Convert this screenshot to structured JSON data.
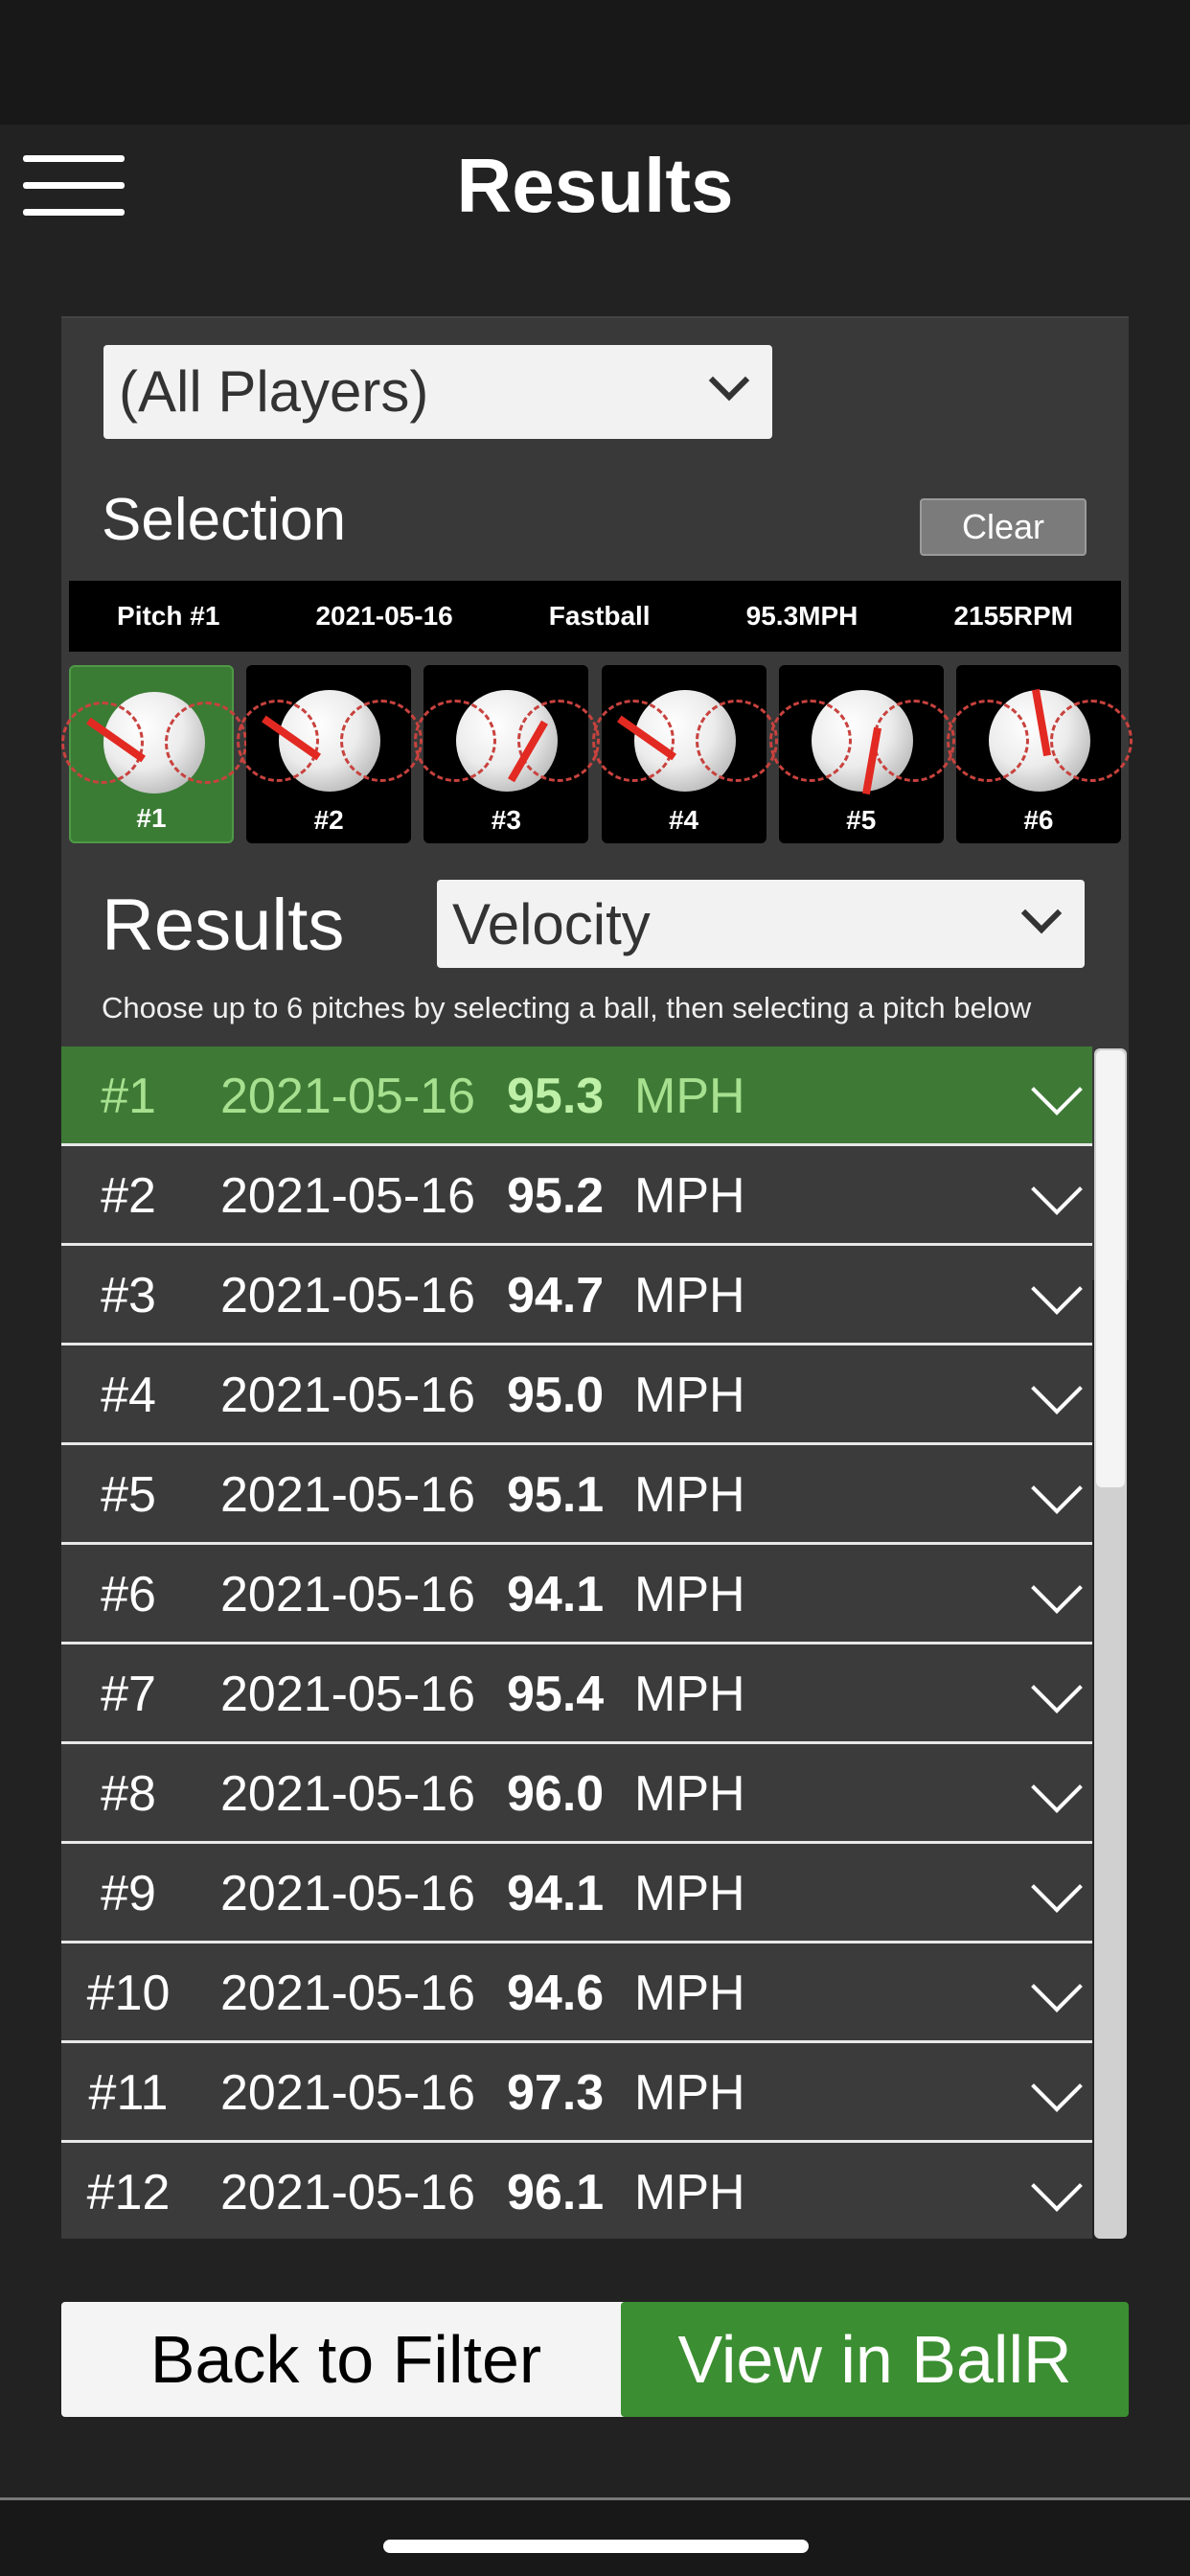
{
  "header": {
    "title": "Results"
  },
  "filters": {
    "player": "(All Players)",
    "metric": "Velocity"
  },
  "selection": {
    "label": "Selection",
    "clear_label": "Clear",
    "info": {
      "pitch": "Pitch #1",
      "date": "2021-05-16",
      "type": "Fastball",
      "speed": "95.3MPH",
      "spin": "2155RPM"
    },
    "balls": [
      {
        "label": "#1"
      },
      {
        "label": "#2"
      },
      {
        "label": "#3"
      },
      {
        "label": "#4"
      },
      {
        "label": "#5"
      },
      {
        "label": "#6"
      }
    ]
  },
  "results": {
    "label": "Results",
    "hint": "Choose up to 6 pitches by selecting a ball, then selecting a pitch below",
    "rows": [
      {
        "num": "#1",
        "date": "2021-05-16",
        "value": "95.3",
        "unit": "MPH"
      },
      {
        "num": "#2",
        "date": "2021-05-16",
        "value": "95.2",
        "unit": "MPH"
      },
      {
        "num": "#3",
        "date": "2021-05-16",
        "value": "94.7",
        "unit": "MPH"
      },
      {
        "num": "#4",
        "date": "2021-05-16",
        "value": "95.0",
        "unit": "MPH"
      },
      {
        "num": "#5",
        "date": "2021-05-16",
        "value": "95.1",
        "unit": "MPH"
      },
      {
        "num": "#6",
        "date": "2021-05-16",
        "value": "94.1",
        "unit": "MPH"
      },
      {
        "num": "#7",
        "date": "2021-05-16",
        "value": "95.4",
        "unit": "MPH"
      },
      {
        "num": "#8",
        "date": "2021-05-16",
        "value": "96.0",
        "unit": "MPH"
      },
      {
        "num": "#9",
        "date": "2021-05-16",
        "value": "94.1",
        "unit": "MPH"
      },
      {
        "num": "#10",
        "date": "2021-05-16",
        "value": "94.6",
        "unit": "MPH"
      },
      {
        "num": "#11",
        "date": "2021-05-16",
        "value": "97.3",
        "unit": "MPH"
      },
      {
        "num": "#12",
        "date": "2021-05-16",
        "value": "96.1",
        "unit": "MPH"
      }
    ]
  },
  "footer": {
    "back_label": "Back to Filter",
    "view_label": "View in BallR"
  },
  "colors": {
    "accent": "#3b8e31",
    "selected_row": "#3e7a36",
    "background": "#222222",
    "panel": "#393939"
  }
}
